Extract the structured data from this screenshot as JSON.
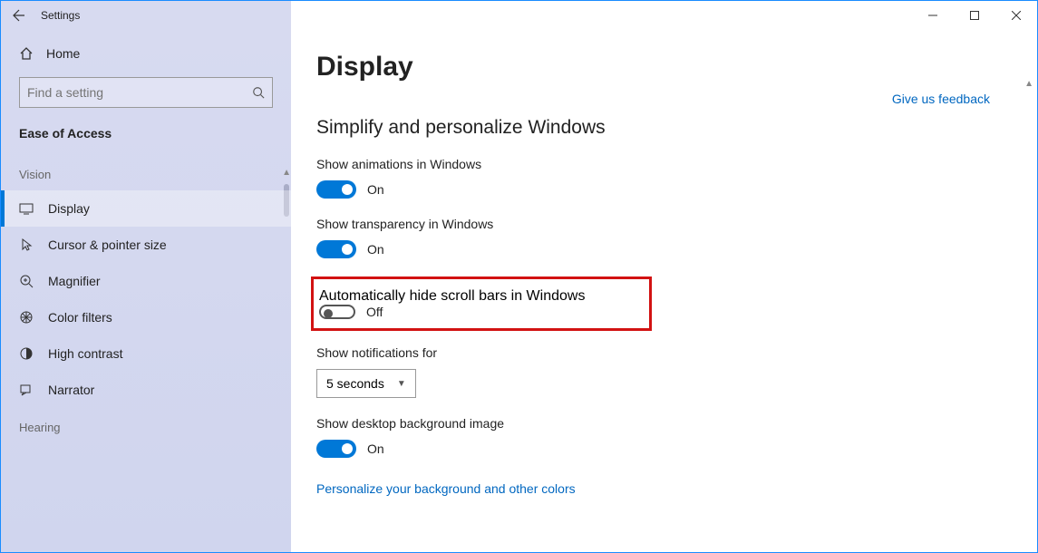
{
  "titlebar": {
    "back_aria": "Back",
    "title": "Settings"
  },
  "sidebar": {
    "home": "Home",
    "search_placeholder": "Find a setting",
    "category": "Ease of Access",
    "groups": [
      {
        "label": "Vision",
        "items": [
          {
            "key": "display",
            "label": "Display",
            "selected": true
          },
          {
            "key": "cursor",
            "label": "Cursor & pointer size"
          },
          {
            "key": "magnifier",
            "label": "Magnifier"
          },
          {
            "key": "colorfilters",
            "label": "Color filters"
          },
          {
            "key": "highcontrast",
            "label": "High contrast"
          },
          {
            "key": "narrator",
            "label": "Narrator"
          }
        ]
      },
      {
        "label": "Hearing",
        "items": []
      }
    ]
  },
  "main": {
    "page_title": "Display",
    "feedback": "Give us feedback",
    "section_title": "Simplify and personalize Windows",
    "settings": {
      "animations": {
        "label": "Show animations in Windows",
        "on": true,
        "state": "On"
      },
      "transparency": {
        "label": "Show transparency in Windows",
        "on": true,
        "state": "On"
      },
      "hide_scroll": {
        "label": "Automatically hide scroll bars in Windows",
        "on": false,
        "state": "Off"
      },
      "notifications": {
        "label": "Show notifications for",
        "value": "5 seconds"
      },
      "desktop_bg": {
        "label": "Show desktop background image",
        "on": true,
        "state": "On"
      }
    },
    "personalize_link": "Personalize your background and other colors"
  }
}
